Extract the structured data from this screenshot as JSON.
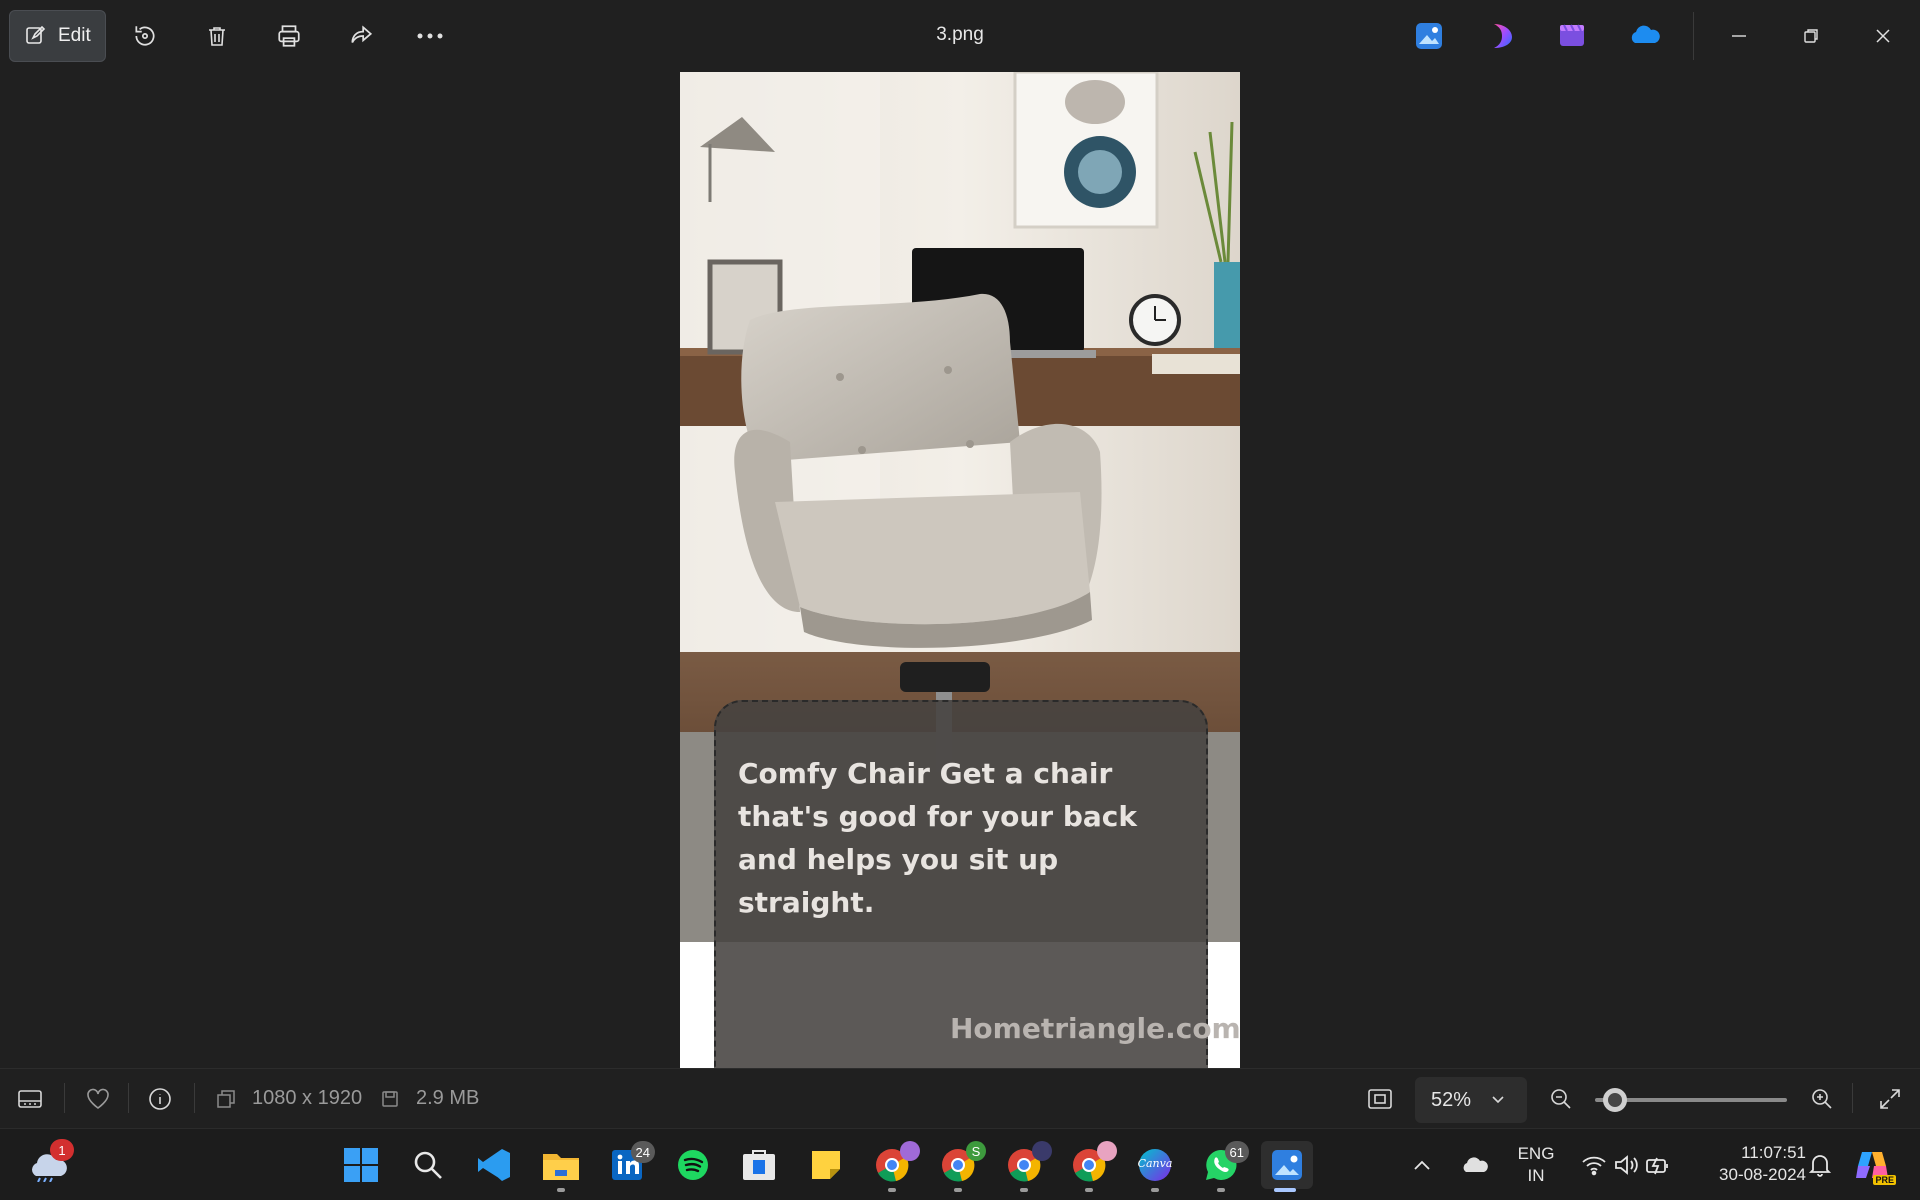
{
  "toolbar": {
    "edit_label": "Edit",
    "icons": [
      "edit-icon",
      "rotate-icon",
      "delete-icon",
      "print-icon",
      "share-icon",
      "more-icon"
    ]
  },
  "window": {
    "title": "3.png",
    "app_icons": [
      "photos-app-icon",
      "designer-app-icon",
      "clipchamp-icon",
      "onedrive-icon"
    ]
  },
  "image": {
    "caption": "Comfy Chair Get a chair that's good for your back and helps you sit up straight.",
    "watermark": "Hometriangle.com"
  },
  "infobar": {
    "dimensions": "1080 x 1920",
    "file_size": "2.9 MB",
    "zoom": "52%",
    "zoom_fraction": 0.04
  },
  "taskbar": {
    "weather_badge": "1",
    "linkedin_badge": "24",
    "whatsapp_badge": "61",
    "chrome_profile_badge": "S",
    "canva_label": "Canva",
    "lang_top": "ENG",
    "lang_bottom": "IN",
    "time": "11:07:51",
    "date": "30-08-2024",
    "copilot_label": "PRE"
  },
  "colors": {
    "background": "#202020",
    "taskbar": "#1c1c1c",
    "accent": "#a9c8ff"
  }
}
